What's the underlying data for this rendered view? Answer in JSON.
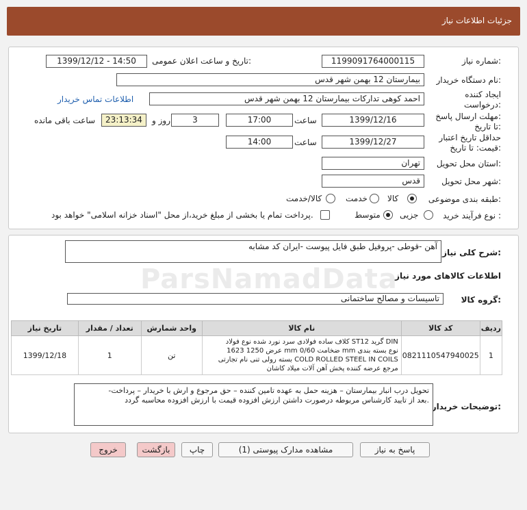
{
  "header": {
    "title": "جزئیات اطلاعات نیاز"
  },
  "fields": {
    "need_number_label": "شماره نیاز:",
    "need_number": "1199091764000115",
    "announce_label": "تاریخ و ساعت اعلان عمومی:",
    "announce_value": "1399/12/12 - 14:50",
    "buyer_org_label": "نام دستگاه خریدار:",
    "buyer_org": "بیمارستان 12 بهمن شهر قدس",
    "creator_label_1": "ایجاد کننده",
    "creator_label_2": "درخواست:",
    "creator": "احمد کوهی تدارکات بیمارستان 12 بهمن شهر قدس",
    "contact_link": "اطلاعات تماس خریدار",
    "reply_deadline_label_1": "مهلت ارسال پاسخ:",
    "reply_deadline_label_2": "تا تاریخ:",
    "reply_date": "1399/12/16",
    "time_label": "ساعت",
    "reply_time": "17:00",
    "days_value": "3",
    "days_label": "روز و",
    "remaining_time": "23:13:34",
    "remaining_label": "ساعت باقی مانده",
    "validity_label_1": "حداقل تاریخ اعتبار",
    "validity_label_2": "قیمت: تا تاریخ:",
    "validity_date": "1399/12/27",
    "validity_time": "14:00",
    "province_label": "استان محل تحویل:",
    "province": "تهران",
    "city_label": "شهر محل تحویل:",
    "city": "قدس",
    "category_label": "طبقه بندی موضوعی:",
    "category_options": [
      "کالا",
      "خدمت",
      "کالا/خدمت"
    ],
    "category_selected": "کالا",
    "process_label": "نوع فرآیند خرید :",
    "process_options": [
      "جزیی",
      "متوسط"
    ],
    "process_selected": "متوسط",
    "payment_note": "پرداخت تمام یا بخشی از مبلغ خرید،از محل \"اسناد خزانه اسلامی\" خواهد بود."
  },
  "summary": {
    "label": "شرح کلی نیاز:",
    "value": "آهن -قوطی -پروفیل طبق فایل پیوست -ایران کد مشابه"
  },
  "goods_section_title": "اطلاعات کالاهای مورد نیاز",
  "goods_group": {
    "label": "گروه کالا:",
    "value": "تاسیسات و مصالح ساختمانی"
  },
  "table": {
    "headers": [
      "ردیف",
      "کد کالا",
      "نام کالا",
      "واحد شمارش",
      "تعداد / مقدار",
      "تاریخ نیاز"
    ],
    "rows": [
      {
        "index": "1",
        "code": "0821110547940025",
        "name_lines": [
          "کلاف ساده فولادی سرد نورد شده نوع فولاد ST12 گرید DIN",
          "1623 عرض 1250 mm ضخامت 0/60 mm نوع بسته بندی",
          "بسته رولی تنی نام تجارتی COLD ROLLED STEEL IN COILS",
          "مرجع عرضه کننده پخش آهن آلات میلاد کاشان"
        ],
        "unit": "تن",
        "qty": "1",
        "date": "1399/12/18"
      }
    ]
  },
  "notes": {
    "label": "توضیحات خریدار:",
    "lines": [
      "-تحویل درب انبار بیمارستان – هزینه حمل به عهده تامین کننده – حق مرجوع و ارش با خریدار – پرداخت",
      "بعد از تایید کارشناس مربوطه درصورت داشتن ارزش افزوده قیمت با ارزش افزوده محاسبه گردد."
    ]
  },
  "buttons": {
    "reply": "پاسخ به نیاز",
    "attachments": "مشاهده مدارک پیوستی (1)",
    "print": "چاپ",
    "back": "بازگشت",
    "exit": "خروج"
  },
  "watermark": "ParsNamadData"
}
